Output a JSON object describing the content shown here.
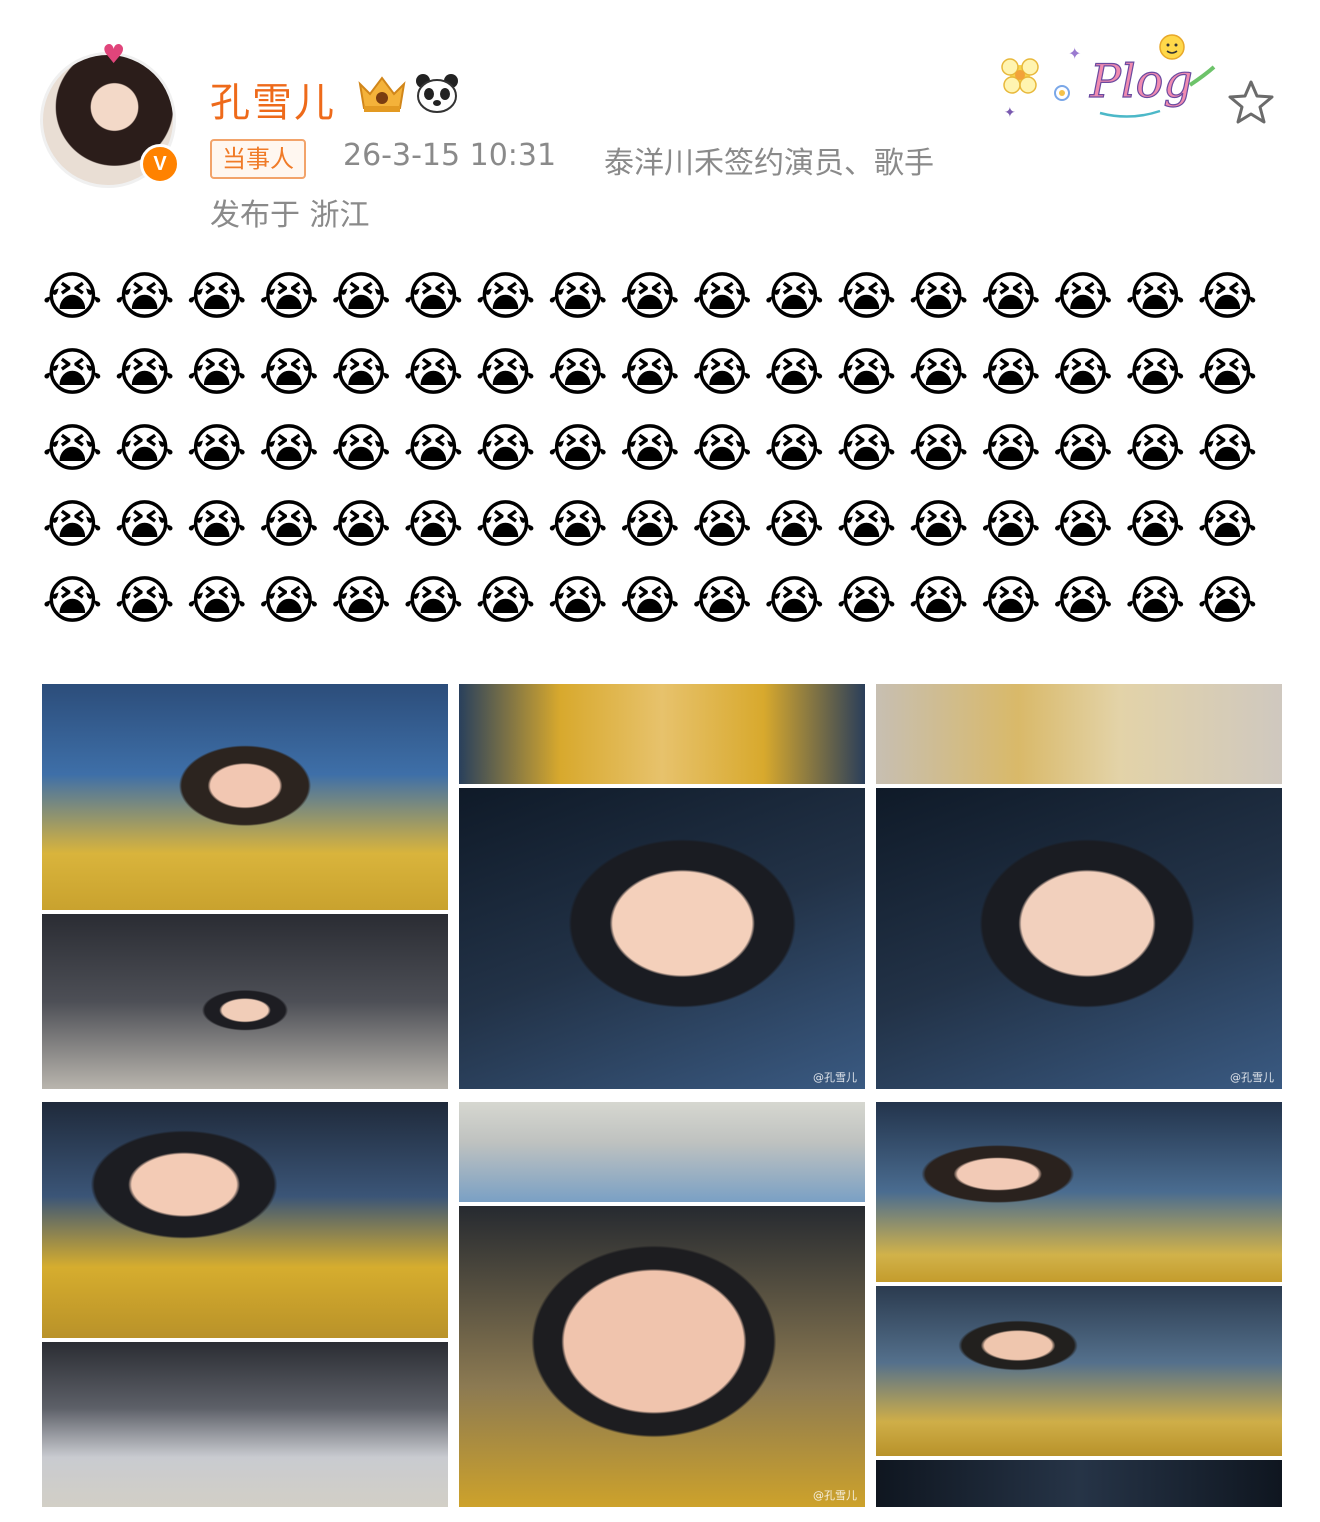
{
  "post": {
    "author": "孔雪儿",
    "tag": "当事人",
    "time": "26-3-15 10:31",
    "source": "泰洋川禾签约演员、歌手",
    "location": "发布于 浙江",
    "sticker_text": "Plog",
    "verified_badge": "V"
  },
  "emojis": {
    "glyph": "😭",
    "rows": 5,
    "per_row": 17
  },
  "photos": [
    {
      "watermark": ""
    },
    {
      "watermark": "@孔雪儿"
    },
    {
      "watermark": "@孔雪儿"
    },
    {
      "watermark": ""
    },
    {
      "watermark": "@孔雪儿"
    },
    {
      "watermark": ""
    }
  ],
  "icons": {
    "crown": "crown-icon",
    "panda": "panda-icon",
    "star": "star-icon",
    "verified": "verified-icon"
  },
  "colors": {
    "username": "#ee6a1a",
    "tag_border": "#f2a36a",
    "meta_text": "#8a8a8a",
    "verified": "#ff8200"
  }
}
